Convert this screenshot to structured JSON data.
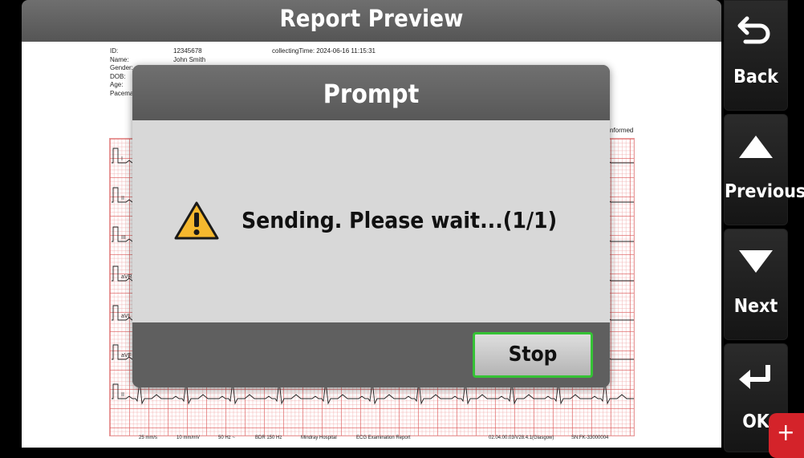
{
  "header": {
    "title": "Report Preview"
  },
  "report": {
    "id_label": "ID:",
    "id_value": "12345678",
    "name_label": "Name:",
    "name_value": "John Smith",
    "gender_label": "Gender:",
    "dob_label": "DOB:",
    "age_label": "Age:",
    "pacemaker_label": "Pacema",
    "collecting_time": "collectingTime: 2024-06-16 11:15:31",
    "partial_right_text": "nformed",
    "leads": [
      "I",
      "II",
      "III",
      "aVR",
      "aVL",
      "aVF",
      "II"
    ],
    "footer": {
      "speed": "25 mm/s",
      "gain": "10 mm/mV",
      "notch": "50 Hz ~",
      "filter": "BDR  150 Hz",
      "hospital": "Mindray Hospital",
      "report_type": "ECG Examination Report",
      "version": "02.04.00.03/V28.4.1(Glasgow)",
      "serial": "SN:FK-33000004"
    }
  },
  "sidebar": {
    "back_label": "Back",
    "previous_label": "Previous",
    "next_label": "Next",
    "ok_label": "OK"
  },
  "modal": {
    "title": "Prompt",
    "message": "Sending. Please wait...(1/1)",
    "stop_label": "Stop",
    "icon": "warning-icon"
  },
  "colors": {
    "warning_fill": "#f5b82e",
    "stop_border": "#35c235",
    "plus_button": "#d4232a"
  },
  "plus_button_glyph": "+"
}
